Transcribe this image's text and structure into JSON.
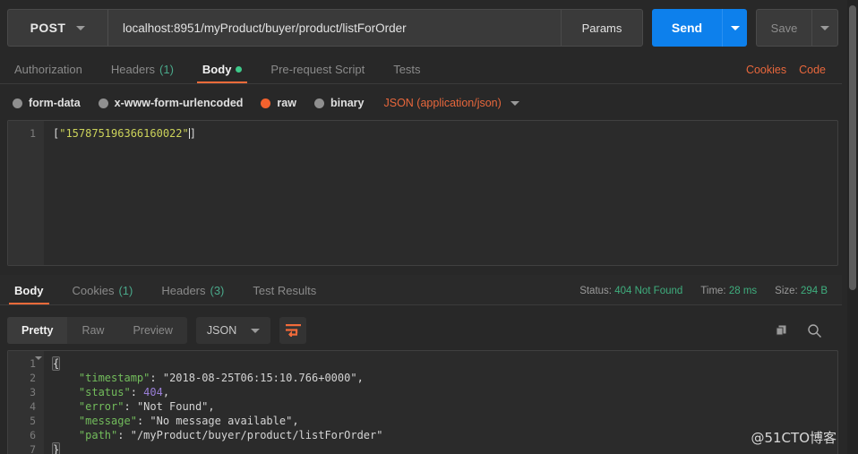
{
  "request_bar": {
    "method": "POST",
    "url": "localhost:8951/myProduct/buyer/product/listForOrder",
    "params_label": "Params",
    "send_label": "Send",
    "save_label": "Save"
  },
  "request_tabs": [
    {
      "label": "Authorization",
      "count": "",
      "active": false,
      "dot": false
    },
    {
      "label": "Headers",
      "count": "(1)",
      "active": false,
      "dot": false
    },
    {
      "label": "Body",
      "count": "",
      "active": true,
      "dot": true
    },
    {
      "label": "Pre-request Script",
      "count": "",
      "active": false,
      "dot": false
    },
    {
      "label": "Tests",
      "count": "",
      "active": false,
      "dot": false
    }
  ],
  "request_tab_links": {
    "cookies": "Cookies",
    "code": "Code"
  },
  "body_types": [
    {
      "label": "form-data",
      "selected": false
    },
    {
      "label": "x-www-form-urlencoded",
      "selected": false
    },
    {
      "label": "raw",
      "selected": true
    },
    {
      "label": "binary",
      "selected": false
    }
  ],
  "body_format": "JSON (application/json)",
  "request_body": {
    "line_numbers": [
      "1"
    ],
    "open_bracket": "[",
    "string_value": "\"157875196366160022\"",
    "close_bracket": "]"
  },
  "response_tabs": [
    {
      "label": "Body",
      "count": "",
      "active": true
    },
    {
      "label": "Cookies",
      "count": "(1)",
      "active": false
    },
    {
      "label": "Headers",
      "count": "(3)",
      "active": false
    },
    {
      "label": "Test Results",
      "count": "",
      "active": false
    }
  ],
  "response_meta": {
    "status_key": "Status:",
    "status_value": "404 Not Found",
    "time_key": "Time:",
    "time_value": "28 ms",
    "size_key": "Size:",
    "size_value": "294 B"
  },
  "response_toolbar": {
    "view_modes": [
      {
        "label": "Pretty",
        "active": true
      },
      {
        "label": "Raw",
        "active": false
      },
      {
        "label": "Preview",
        "active": false
      }
    ],
    "format": "JSON",
    "wrap_icon": "word-wrap-icon",
    "copy_icon": "copy-icon",
    "search_icon": "search-icon"
  },
  "response_body": {
    "line_numbers": [
      "1",
      "2",
      "3",
      "4",
      "5",
      "6",
      "7"
    ],
    "lines": [
      {
        "open": "{"
      },
      {
        "key": "\"timestamp\"",
        "sep": ": ",
        "value": "\"2018-08-25T06:15:10.766+0000\"",
        "type": "string",
        "comma": ","
      },
      {
        "key": "\"status\"",
        "sep": ": ",
        "value": "404",
        "type": "number",
        "comma": ","
      },
      {
        "key": "\"error\"",
        "sep": ": ",
        "value": "\"Not Found\"",
        "type": "string",
        "comma": ","
      },
      {
        "key": "\"message\"",
        "sep": ": ",
        "value": "\"No message available\"",
        "type": "string",
        "comma": ","
      },
      {
        "key": "\"path\"",
        "sep": ": ",
        "value": "\"/myProduct/buyer/product/listForOrder\"",
        "type": "string",
        "comma": ""
      },
      {
        "close": "}"
      }
    ]
  },
  "watermark": "@51CTO博客",
  "colors": {
    "accent_orange": "#f26b3a",
    "send_blue": "#0d80ec",
    "status_green": "#3fae7e",
    "json_key_green": "#73bd5c",
    "json_number_purple": "#9a7fd8",
    "request_string_yellow": "#ccd35a"
  }
}
